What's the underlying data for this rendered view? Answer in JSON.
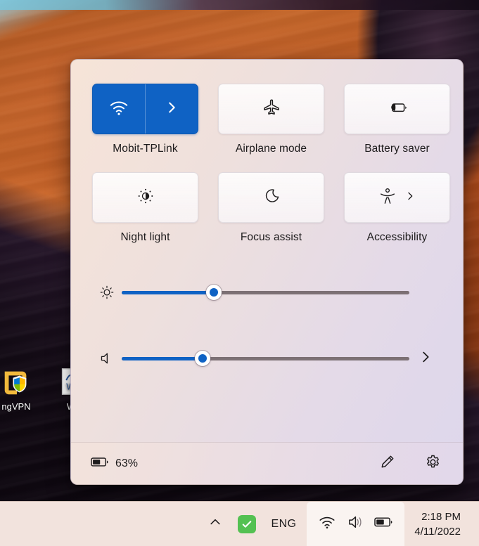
{
  "desktop": {
    "icons": [
      {
        "name": "vpn-shortcut",
        "label": "ngVPN"
      },
      {
        "name": "word-shortcut",
        "label": "W"
      }
    ]
  },
  "quick_settings": {
    "accent_color": "#0f62c4",
    "tiles": [
      {
        "name": "wifi",
        "label": "Mobit-TPLink",
        "icon": "wifi-icon",
        "state": "on",
        "has_chevron": true,
        "split": true
      },
      {
        "name": "airplane-mode",
        "label": "Airplane mode",
        "icon": "airplane-icon",
        "state": "off",
        "has_chevron": false,
        "split": false
      },
      {
        "name": "battery-saver",
        "label": "Battery saver",
        "icon": "battery-leaf-icon",
        "state": "off",
        "has_chevron": false,
        "split": false
      },
      {
        "name": "night-light",
        "label": "Night light",
        "icon": "brightness-sun-icon",
        "state": "off",
        "has_chevron": false,
        "split": false
      },
      {
        "name": "focus-assist",
        "label": "Focus assist",
        "icon": "moon-icon",
        "state": "off",
        "has_chevron": false,
        "split": false
      },
      {
        "name": "accessibility",
        "label": "Accessibility",
        "icon": "accessibility-icon",
        "state": "off",
        "has_chevron": true,
        "split": false
      }
    ],
    "sliders": [
      {
        "name": "brightness",
        "icon": "brightness-icon",
        "value": 32,
        "trailing_icon": null
      },
      {
        "name": "volume",
        "icon": "speaker-icon",
        "value": 28,
        "trailing_icon": "chevron-right-icon"
      }
    ],
    "footer": {
      "battery_icon": "battery-icon",
      "battery_percent": "63%",
      "edit_label": "edit-quick-settings",
      "settings_label": "open-settings"
    }
  },
  "taskbar": {
    "overflow_icon": "chevron-up-icon",
    "security_icon": "shield-check-icon",
    "language": "ENG",
    "status_icons": [
      "wifi-icon",
      "volume-icon",
      "battery-icon"
    ],
    "clock": {
      "time": "2:18 PM",
      "date": "4/11/2022"
    }
  }
}
